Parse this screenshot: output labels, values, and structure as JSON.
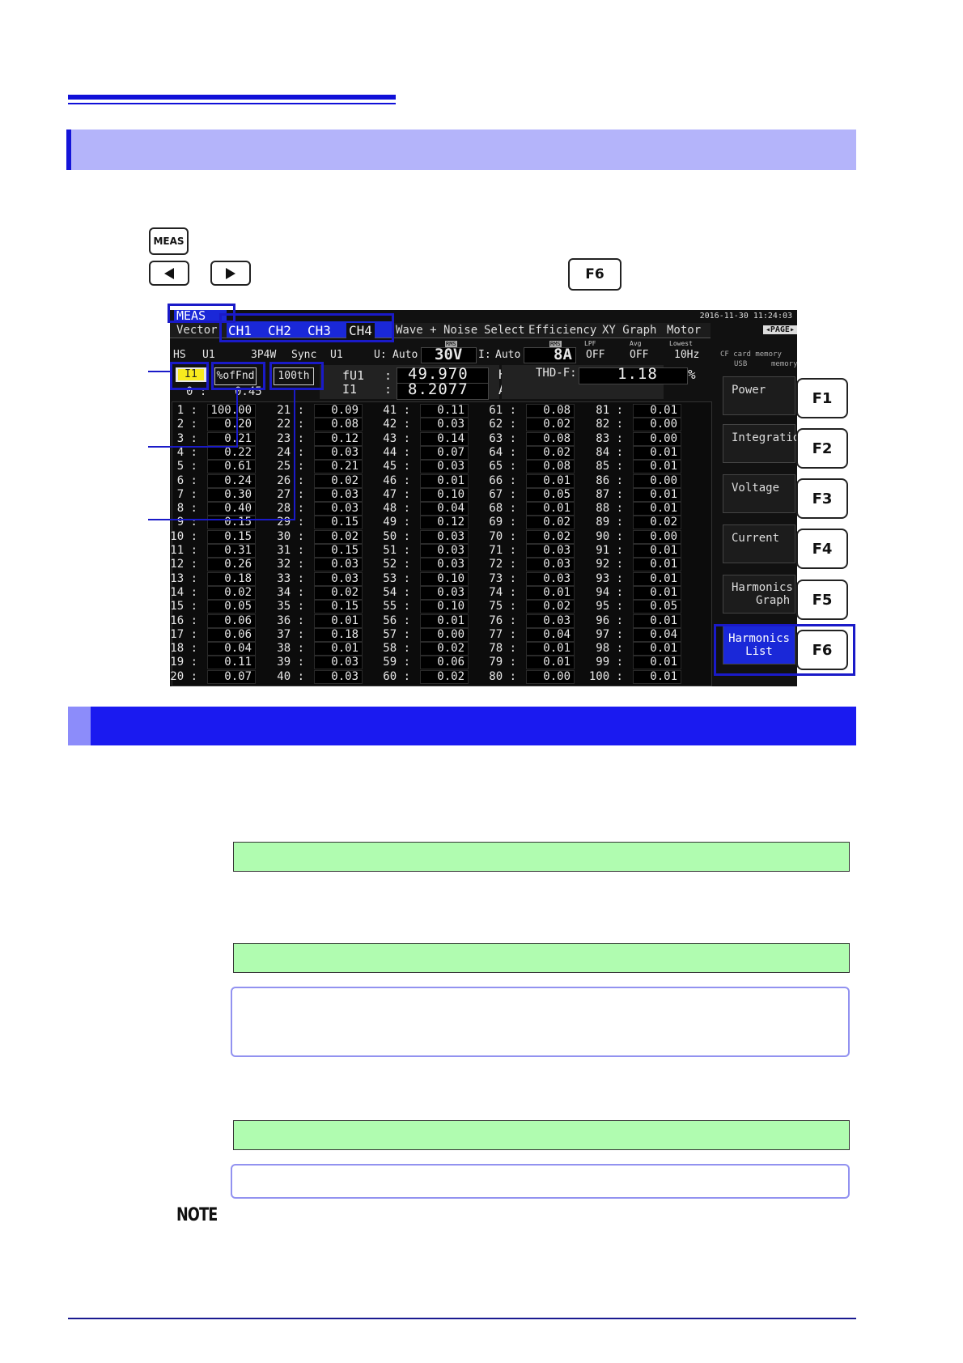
{
  "keys": {
    "meas": "MEAS",
    "f6": "F6"
  },
  "screen": {
    "meas_tab": "MEAS",
    "vector_tab": "Vector",
    "channels": [
      "CH1",
      "CH2",
      "CH3",
      "CH4"
    ],
    "tabs": [
      "Wave + Noise",
      "Select",
      "Efficiency",
      "XY Graph",
      "Motor"
    ],
    "timestamp": "2016-11-30 11:24:03",
    "page_label": "PAGE",
    "hs": "HS",
    "hs_val": "U1",
    "wiring": "3P4W",
    "sync": "Sync",
    "sync_val": "U1",
    "u_lbl": "U:",
    "u_auto": "Auto",
    "u_range": "30V",
    "i_lbl": "I:",
    "i_auto": "Auto",
    "i_range": "8A",
    "rms1": "RMS",
    "rms2": "RMS",
    "lpf_lbl": "LPF",
    "lpf_val": "OFF",
    "avg_lbl": "Avg",
    "avg_val": "OFF",
    "lowest_lbl": "Lowest",
    "lowest_val": "10Hz",
    "cf_label": "CF card memory",
    "usb_label": "USB",
    "usb_memory": "memory",
    "param": "I1",
    "display_mode": "%ofFnd",
    "order": "100th",
    "freq_lbl": "fU1",
    "freq_sep": ":",
    "freq_val": "49.970",
    "freq_unit": "Hz",
    "i_meas_lbl": "I1",
    "i_meas_sep": ":",
    "i_meas_val": "8.2077",
    "i_meas_unit": "A",
    "thd_lbl": "THD-F:",
    "thd_val": "1.18",
    "thd_unit": "%",
    "row0_lbl": "0 :",
    "row0_val": "0.45",
    "harmonics": [
      [
        "1",
        "100.00"
      ],
      [
        "2",
        "0.20"
      ],
      [
        "3",
        "0.21"
      ],
      [
        "4",
        "0.22"
      ],
      [
        "5",
        "0.61"
      ],
      [
        "6",
        "0.24"
      ],
      [
        "7",
        "0.30"
      ],
      [
        "8",
        "0.40"
      ],
      [
        "9",
        "0.15"
      ],
      [
        "10",
        "0.15"
      ],
      [
        "11",
        "0.31"
      ],
      [
        "12",
        "0.26"
      ],
      [
        "13",
        "0.18"
      ],
      [
        "14",
        "0.02"
      ],
      [
        "15",
        "0.05"
      ],
      [
        "16",
        "0.06"
      ],
      [
        "17",
        "0.06"
      ],
      [
        "18",
        "0.04"
      ],
      [
        "19",
        "0.11"
      ],
      [
        "20",
        "0.07"
      ],
      [
        "21",
        "0.09"
      ],
      [
        "22",
        "0.08"
      ],
      [
        "23",
        "0.12"
      ],
      [
        "24",
        "0.03"
      ],
      [
        "25",
        "0.21"
      ],
      [
        "26",
        "0.02"
      ],
      [
        "27",
        "0.03"
      ],
      [
        "28",
        "0.03"
      ],
      [
        "29",
        "0.15"
      ],
      [
        "30",
        "0.02"
      ],
      [
        "31",
        "0.15"
      ],
      [
        "32",
        "0.03"
      ],
      [
        "33",
        "0.03"
      ],
      [
        "34",
        "0.02"
      ],
      [
        "35",
        "0.15"
      ],
      [
        "36",
        "0.01"
      ],
      [
        "37",
        "0.18"
      ],
      [
        "38",
        "0.01"
      ],
      [
        "39",
        "0.03"
      ],
      [
        "40",
        "0.03"
      ],
      [
        "41",
        "0.11"
      ],
      [
        "42",
        "0.03"
      ],
      [
        "43",
        "0.14"
      ],
      [
        "44",
        "0.07"
      ],
      [
        "45",
        "0.03"
      ],
      [
        "46",
        "0.01"
      ],
      [
        "47",
        "0.10"
      ],
      [
        "48",
        "0.04"
      ],
      [
        "49",
        "0.12"
      ],
      [
        "50",
        "0.03"
      ],
      [
        "51",
        "0.03"
      ],
      [
        "52",
        "0.03"
      ],
      [
        "53",
        "0.10"
      ],
      [
        "54",
        "0.03"
      ],
      [
        "55",
        "0.10"
      ],
      [
        "56",
        "0.01"
      ],
      [
        "57",
        "0.00"
      ],
      [
        "58",
        "0.02"
      ],
      [
        "59",
        "0.06"
      ],
      [
        "60",
        "0.02"
      ],
      [
        "61",
        "0.08"
      ],
      [
        "62",
        "0.02"
      ],
      [
        "63",
        "0.08"
      ],
      [
        "64",
        "0.02"
      ],
      [
        "65",
        "0.08"
      ],
      [
        "66",
        "0.01"
      ],
      [
        "67",
        "0.05"
      ],
      [
        "68",
        "0.01"
      ],
      [
        "69",
        "0.02"
      ],
      [
        "70",
        "0.02"
      ],
      [
        "71",
        "0.03"
      ],
      [
        "72",
        "0.03"
      ],
      [
        "73",
        "0.03"
      ],
      [
        "74",
        "0.01"
      ],
      [
        "75",
        "0.02"
      ],
      [
        "76",
        "0.03"
      ],
      [
        "77",
        "0.04"
      ],
      [
        "78",
        "0.01"
      ],
      [
        "79",
        "0.01"
      ],
      [
        "80",
        "0.00"
      ],
      [
        "81",
        "0.01"
      ],
      [
        "82",
        "0.00"
      ],
      [
        "83",
        "0.00"
      ],
      [
        "84",
        "0.01"
      ],
      [
        "85",
        "0.01"
      ],
      [
        "86",
        "0.00"
      ],
      [
        "87",
        "0.01"
      ],
      [
        "88",
        "0.01"
      ],
      [
        "89",
        "0.02"
      ],
      [
        "90",
        "0.00"
      ],
      [
        "91",
        "0.01"
      ],
      [
        "92",
        "0.01"
      ],
      [
        "93",
        "0.01"
      ],
      [
        "94",
        "0.01"
      ],
      [
        "95",
        "0.05"
      ],
      [
        "96",
        "0.01"
      ],
      [
        "97",
        "0.04"
      ],
      [
        "98",
        "0.01"
      ],
      [
        "99",
        "0.01"
      ],
      [
        "100",
        "0.01"
      ]
    ],
    "fkeys": [
      {
        "label": "Power",
        "key": "F1"
      },
      {
        "label": "Integration",
        "key": "F2"
      },
      {
        "label": "Voltage",
        "key": "F3"
      },
      {
        "label": "Current",
        "key": "F4"
      },
      {
        "label": "Harmonics Graph",
        "line1": "Harmonics",
        "line2": "Graph",
        "key": "F5"
      },
      {
        "label": "Harmonics List",
        "line1": "Harmonics",
        "line2": "List",
        "key": "F6"
      }
    ]
  },
  "note_label": "NOTE",
  "colors": {
    "accent": "#1a1af0",
    "section": "#b4b4fa",
    "green": "#b0fcb0",
    "highlight": "#f8ea1e"
  }
}
